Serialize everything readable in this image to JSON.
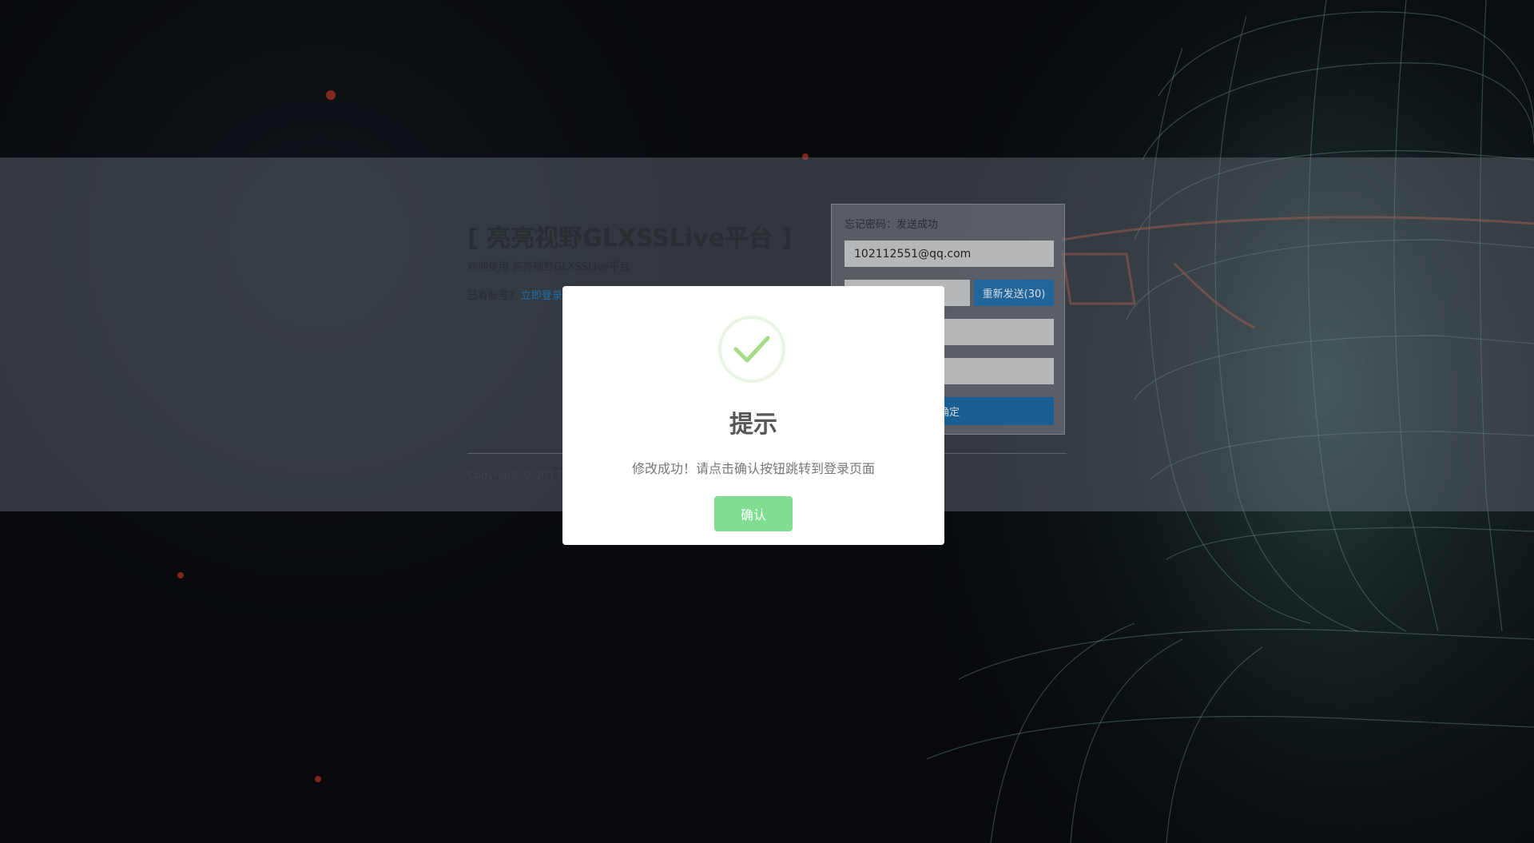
{
  "brand": {
    "title": "[ 亮亮视野GLXSSLive平台 ]",
    "subtitle": "欢迎使用 亮亮视野GLXSSLive平台",
    "have_account": "已有账号?",
    "login_link": "立即登录",
    "copyright": "Copyright © 2017 亮"
  },
  "form": {
    "title": "忘记密码：发送成功",
    "email_value": "102112551@qq.com",
    "resend_label": "重新发送(30)",
    "submit_label": "确定"
  },
  "modal": {
    "icon": "check-icon",
    "title": "提示",
    "message": "修改成功！请点击确认按钮跳转到登录页面",
    "confirm_label": "确认"
  },
  "colors": {
    "confirm_button": "#7fde8f",
    "check_mark": "#a5dc86",
    "resend_button": "#20659b"
  }
}
